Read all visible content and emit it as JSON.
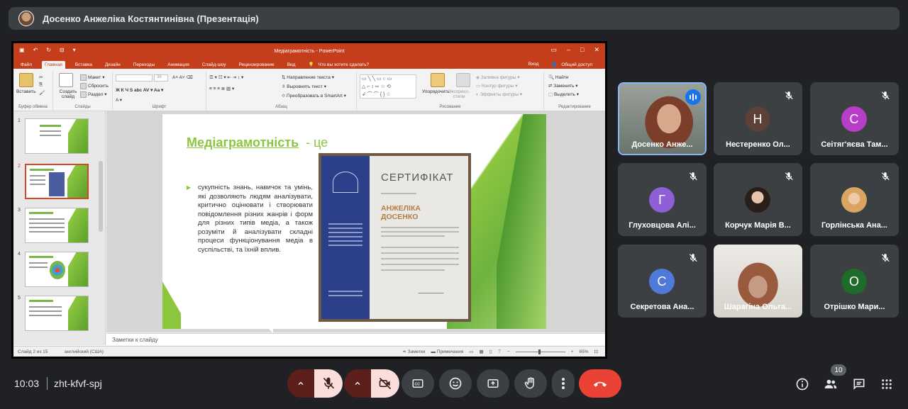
{
  "meeting": {
    "presenter_title": "Досенко Анжеліка Костянтинівна (Презентація)",
    "time": "10:03",
    "code": "zht-kfvf-spj",
    "participant_count": "10"
  },
  "ppt": {
    "window_title": "Медіаграмотність - PowerPoint",
    "tabs": [
      "Файл",
      "Главная",
      "Вставка",
      "Дизайн",
      "Переходы",
      "Анимация",
      "Слайд-шоу",
      "Рецензирование",
      "Вид"
    ],
    "active_tab": "Главная",
    "tell_me": "Что вы хотите сделать?",
    "login": "Вход",
    "share": "Общий доступ",
    "ribbon": {
      "paste": "Вставить",
      "clipboard_group": "Буфер обмена",
      "new_slide": "Создать слайд",
      "layout": "Макет",
      "reset": "Сбросить",
      "section": "Раздел",
      "slides_group": "Слайды",
      "font_size": "36",
      "font_group": "Шрифт",
      "text_direction": "Направление текста",
      "align_text": "Выровнять текст",
      "smartart": "Преобразовать в SmartArt",
      "paragraph_group": "Абзац",
      "arrange": "Упорядочить",
      "express_styles": "Экспресс-стили",
      "fill": "Заливка фигуры",
      "outline": "Контур фигуры",
      "effects": "Эффекты фигуры",
      "drawing_group": "Рисование",
      "find": "Найти",
      "replace": "Заменить",
      "select": "Выделить",
      "editing_group": "Редактирование"
    },
    "thumb_numbers": [
      "1",
      "2",
      "3",
      "4",
      "5"
    ],
    "slide": {
      "title": "Медіаграмотність",
      "title_suffix": "- це",
      "bullet": "сукупність знань, навичок та умінь, які дозволяють людям аналізувати, критично оцінювати і створювати повідомлення різних жанрів і форм для різних типів медіа, а також розуміти й аналізувати складні процеси функціонування медіа в суспільстві, та їхній вплив.",
      "cert_heading": "СЕРТИФІКАТ",
      "cert_name_line1": "АНЖЕЛІКА",
      "cert_name_line2": "ДОСЕНКО"
    },
    "notes_placeholder": "Заметки к слайду",
    "status": {
      "slide_info": "Слайд 2 из 15",
      "language": "английский (США)",
      "notes": "Заметки",
      "comments": "Примечания",
      "zoom": "65%"
    }
  },
  "participants": [
    {
      "name": "Досенко Анже...",
      "type": "video",
      "speaking": true
    },
    {
      "name": "Нестеренко Ол...",
      "initial": "Н",
      "color": "#5d4037"
    },
    {
      "name": "Сеітяг'яєва Там...",
      "initial": "С",
      "color": "#b83ec9"
    },
    {
      "name": "Глуховцова Алі...",
      "initial": "Г",
      "color": "#8e5fd6"
    },
    {
      "name": "Корчук Марія В...",
      "type": "photo"
    },
    {
      "name": "Горлінська Ана...",
      "type": "photo"
    },
    {
      "name": "Секретова Ана...",
      "initial": "С",
      "color": "#4f7ad9"
    },
    {
      "name": "Шарагіна Ольга...",
      "type": "video"
    },
    {
      "name": "Отрішко Мари...",
      "initial": "О",
      "color": "#1e6b2a"
    }
  ]
}
